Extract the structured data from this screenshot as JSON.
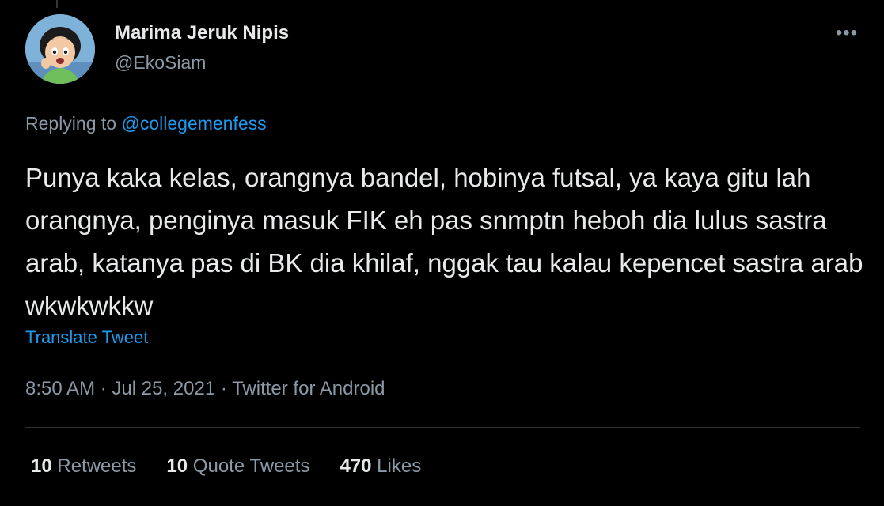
{
  "author": {
    "display_name": "Marima Jeruk Nipis",
    "handle": "@EkoSiam",
    "avatar_icon": "cartoon-girl-avatar"
  },
  "reply": {
    "prefix": "Replying to",
    "mention": "@collegemenfess"
  },
  "tweet": {
    "text": "Punya kaka kelas, orangnya bandel, hobinya futsal, ya kaya gitu lah orangnya, penginya masuk FIK eh pas snmptn heboh dia lulus sastra arab, katanya pas di BK dia khilaf, nggak tau kalau kepencet sastra arab wkwkwkkw",
    "translate_label": "Translate Tweet"
  },
  "meta": {
    "time": "8:50 AM",
    "date": "Jul 25, 2021",
    "source": "Twitter for Android",
    "separator": " · "
  },
  "stats": {
    "retweets_count": "10",
    "retweets_label": "Retweets",
    "quotes_count": "10",
    "quotes_label": "Quote Tweets",
    "likes_count": "470",
    "likes_label": "Likes"
  },
  "more_icon": "ellipsis-icon",
  "colors": {
    "background": "#000000",
    "text": "#e7e9ea",
    "secondary": "#8b98a5",
    "link": "#1d9bf0",
    "divider": "#2f3336"
  }
}
